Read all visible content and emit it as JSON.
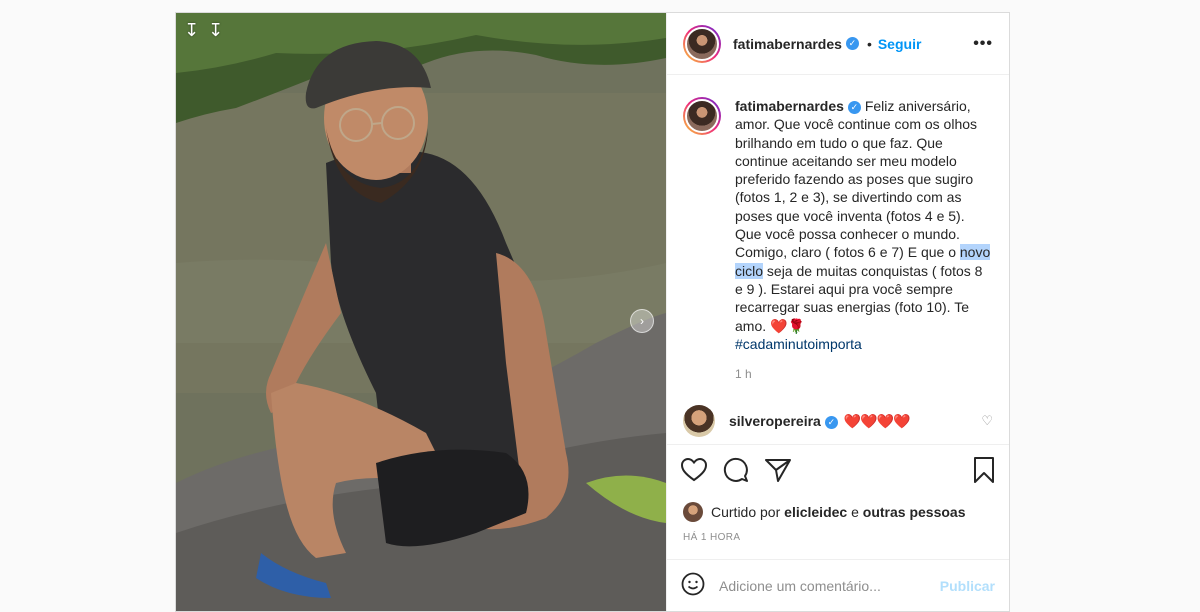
{
  "post": {
    "username": "fatimabernardes",
    "follow_label": "Seguir",
    "more_icon": "more-options-icon",
    "separator": "•"
  },
  "caption": {
    "username": "fatimabernardes",
    "text_before": "Feliz aniversário, amor. Que você continue com os olhos brilhando em tudo o que faz. Que continue aceitando ser meu modelo preferido fazendo as poses que sugiro (fotos 1, 2 e 3), se divertindo com as poses que você inventa (fotos 4 e 5). Que você possa conhecer o mundo. Comigo, claro ( fotos 6 e 7) E que o ",
    "highlighted": "novo ciclo",
    "text_after": " seja de muitas conquistas ( fotos 8 e 9 ). Estarei aqui pra você sempre recarregar suas energias (foto 10). Te amo. ❤️🌹",
    "hashtag": "#cadaminutoimporta",
    "time": "1 h"
  },
  "comment": {
    "username": "silveropereira",
    "text": "❤️❤️❤️❤️"
  },
  "likes": {
    "prefix": "Curtido por",
    "user": "elicleidec",
    "joiner": "e",
    "others": "outras pessoas"
  },
  "posted_ago": "HÁ 1 HORA",
  "add_comment": {
    "placeholder": "Adicione um comentário...",
    "publish_label": "Publicar"
  },
  "colors": {
    "accent": "#0095f6",
    "verified": "#3897f0",
    "highlight": "#b3d4fc",
    "heart": "#ed4956"
  }
}
